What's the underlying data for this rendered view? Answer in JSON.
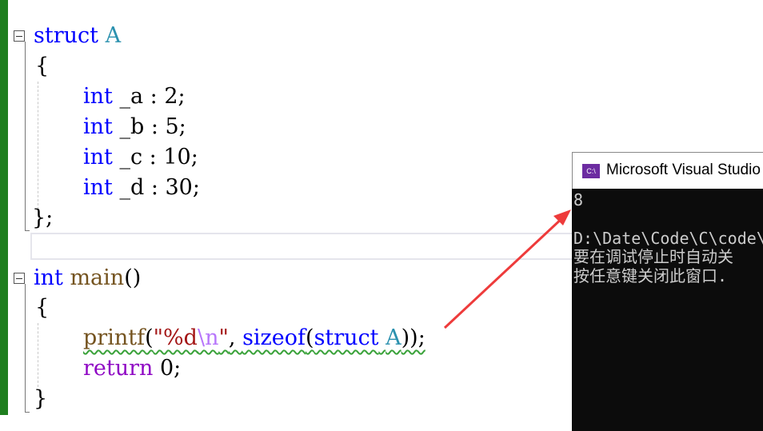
{
  "editor": {
    "struct_block": {
      "kw_struct": "struct",
      "name": "A",
      "open": "{",
      "fields": [
        {
          "type": "int",
          "rest": " _a : 2;"
        },
        {
          "type": "int",
          "rest": " _b : 5;"
        },
        {
          "type": "int",
          "rest": " _c : 10;"
        },
        {
          "type": "int",
          "rest": " _d : 30;"
        }
      ],
      "close": "};"
    },
    "main_block": {
      "kw_int": "int",
      "fn_name": " main",
      "parens": "()",
      "open": "{",
      "printf_fn": "printf",
      "paren_open": "(",
      "str_open": "\"%d",
      "str_escape": "\\n",
      "str_close": "\"",
      "comma": ", ",
      "sizeof_fn": "sizeof",
      "sizeof_open": "(",
      "kw_struct": "struct",
      "struct_name": "A",
      "tail": "));",
      "return_kw": "return",
      "return_rest": " 0;",
      "close": "}"
    }
  },
  "console": {
    "title": "Microsoft Visual Studio",
    "icon_text": "C:\\",
    "lines": [
      "8",
      "",
      "D:\\Date\\Code\\C\\code\\",
      "要在调试停止时自动关",
      "按任意键关闭此窗口."
    ]
  },
  "colors": {
    "keyword": "#0000ff",
    "type": "#2b91af",
    "function": "#74531f",
    "string": "#a31515",
    "control": "#8f08c4",
    "gutter": "#1e7e1e",
    "arrow": "#ee3b3b",
    "console_bg": "#0c0c0c"
  }
}
